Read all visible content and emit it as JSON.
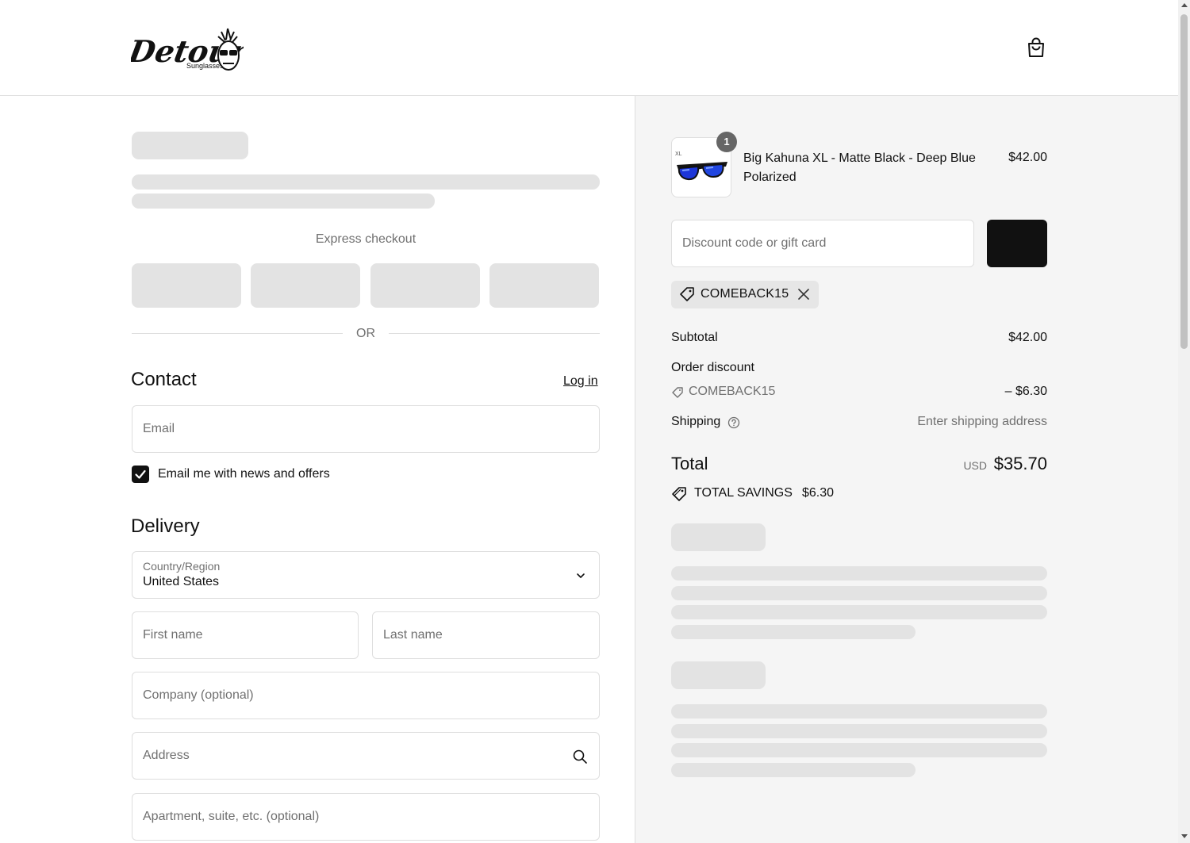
{
  "brand": {
    "logo_text": "Detour",
    "logo_subtext": "Sunglasses"
  },
  "header": {
    "cart_icon": "shopping-bag-icon"
  },
  "express": {
    "label": "Express checkout",
    "divider": "OR"
  },
  "contact": {
    "title": "Contact",
    "login": "Log in",
    "email_placeholder": "Email",
    "newsletter_label": "Email me with news and offers",
    "newsletter_checked": true
  },
  "delivery": {
    "title": "Delivery",
    "country_label": "Country/Region",
    "country_value": "United States",
    "first_name": "First name",
    "last_name": "Last name",
    "company": "Company (optional)",
    "address": "Address",
    "apartment": "Apartment, suite, etc. (optional)"
  },
  "cart": {
    "item": {
      "quantity": "1",
      "name": "Big Kahuna XL - Matte Black - Deep Blue Polarized",
      "price": "$42.00"
    },
    "discount_placeholder": "Discount code or gift card",
    "applied_code": "COMEBACK15"
  },
  "summary": {
    "subtotal_label": "Subtotal",
    "subtotal_value": "$42.00",
    "order_discount_label": "Order discount",
    "discount_code": "COMEBACK15",
    "discount_value": "– $6.30",
    "shipping_label": "Shipping",
    "shipping_value": "Enter shipping address",
    "total_label": "Total",
    "currency": "USD",
    "total_value": "$35.70",
    "savings_label": "TOTAL SAVINGS",
    "savings_value": "$6.30"
  },
  "colors": {
    "accent": "#111111",
    "skeleton": "#e3e3e3",
    "sidebar_bg": "#f5f5f5",
    "border": "#dedede"
  }
}
